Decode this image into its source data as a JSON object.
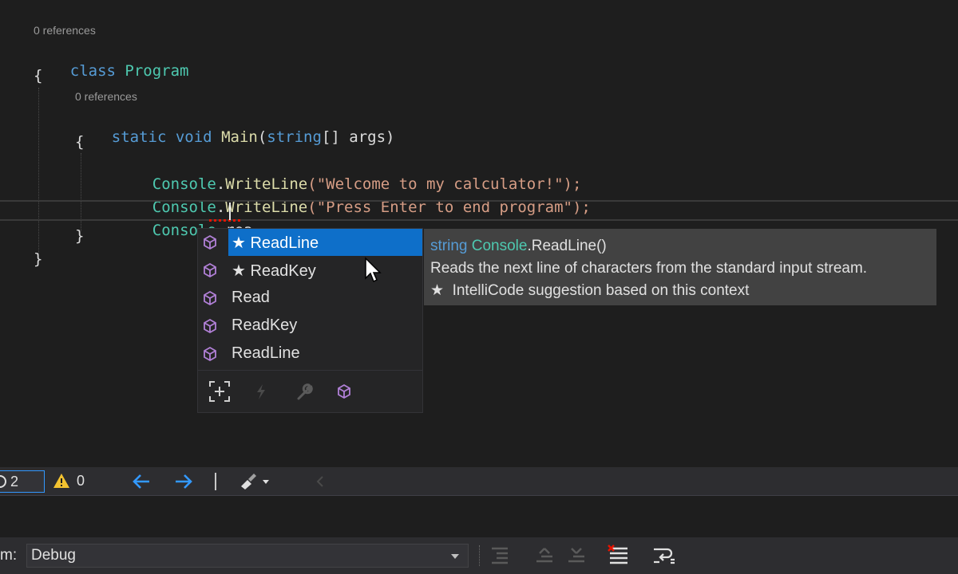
{
  "editor": {
    "codelens_1": "0 references",
    "line_class": {
      "kw": "class",
      "name": "Program"
    },
    "line_open1": "{",
    "codelens_2": "0 references",
    "line_main": {
      "static": "static",
      "void": "void",
      "method": "Main",
      "open": "(",
      "param_type": "string",
      "param_rest": "[] args)"
    },
    "line_open2": "{",
    "line_write1": {
      "cls": "Console",
      "dot": ".",
      "method": "WriteLine",
      "arg": "(\"Welcome to my calculator!\");"
    },
    "line_write2": {
      "cls": "Console",
      "dot": ".",
      "method": "WriteLine",
      "arg": "(\"Press Enter to end program\");"
    },
    "line_typing": {
      "cls": "Console",
      "text": ".rea"
    },
    "line_close2": "}",
    "line_close1": "}"
  },
  "completion": {
    "items": [
      {
        "label": "★ ReadLine",
        "icon": "method-cube-icon",
        "selected": true
      },
      {
        "label": "★ ReadKey",
        "icon": "method-cube-icon"
      },
      {
        "label": "Read",
        "icon": "method-cube-icon"
      },
      {
        "label": "ReadKey",
        "icon": "method-cube-icon"
      },
      {
        "label": "ReadLine",
        "icon": "method-cube-icon"
      }
    ],
    "footer_filters": [
      "expand-scope-icon",
      "event-filter-icon",
      "property-filter-icon",
      "method-filter-icon"
    ]
  },
  "tooltip": {
    "sig_type": "string",
    "sig_class": "Console",
    "sig_rest": ".ReadLine()",
    "description": "Reads the next line of characters from the standard input stream.",
    "intellicode": "★  IntelliCode suggestion based on this context"
  },
  "statusbar": {
    "errors": "2",
    "warnings": "0",
    "icons": [
      "error-icon",
      "warning-icon",
      "arrow-left-icon",
      "arrow-right-icon",
      "brush-icon"
    ]
  },
  "toolbar": {
    "config_label_fragment": "m:",
    "config_value": "Debug"
  },
  "colors": {
    "keyword": "#569cd6",
    "type": "#4ec9b0",
    "string": "#d69d85",
    "method": "#dcdcaa",
    "selection": "#0e6fc9",
    "icon_purple": "#b180d7"
  }
}
